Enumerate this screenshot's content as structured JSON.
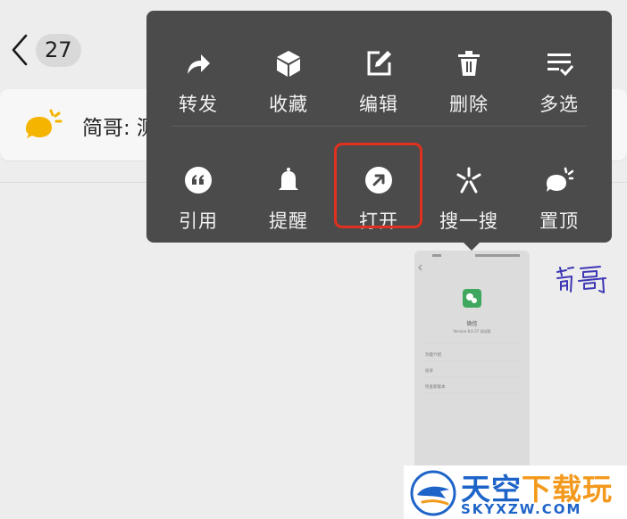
{
  "header": {
    "unread_count": "27"
  },
  "notice": {
    "text": "简哥: 测"
  },
  "menu": {
    "row1": [
      {
        "label": "转发",
        "icon": "forward-icon"
      },
      {
        "label": "收藏",
        "icon": "favorite-cube-icon"
      },
      {
        "label": "编辑",
        "icon": "edit-icon"
      },
      {
        "label": "删除",
        "icon": "delete-icon"
      },
      {
        "label": "多选",
        "icon": "multi-select-icon"
      }
    ],
    "row2": [
      {
        "label": "引用",
        "icon": "quote-icon"
      },
      {
        "label": "提醒",
        "icon": "bell-icon"
      },
      {
        "label": "打开",
        "icon": "open-external-icon"
      },
      {
        "label": "搜一搜",
        "icon": "search-spark-icon"
      },
      {
        "label": "置顶",
        "icon": "pin-top-icon"
      }
    ],
    "highlighted": "打开",
    "highlight_color": "#e0301e"
  },
  "message": {
    "image_caption": "微信",
    "image_version": "Version 8.0.37 测试版",
    "image_rows": [
      "功能介绍",
      "投诉",
      "检查新版本"
    ],
    "signature": "简哥"
  },
  "watermark": {
    "title_main": "天空",
    "title_accent": "下载玩",
    "url": "SKYXZW.COM",
    "brand_blue": "#1e64c8",
    "brand_orange": "#f39a1e"
  },
  "colors": {
    "menu_bg": "#4b4b4b",
    "page_bg": "#ededed",
    "notice_icon": "#f5b400"
  }
}
